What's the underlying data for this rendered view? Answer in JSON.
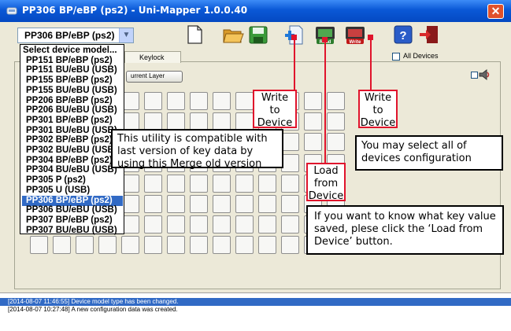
{
  "window": {
    "title": "PP306 BP/eBP (ps2)  - Uni-Mapper 1.0.0.40",
    "close_label": "✕"
  },
  "toolbar": {
    "model_select_value": "PP306 BP/eBP (ps2)",
    "buttons": [
      {
        "name": "new-file",
        "icon": "document-icon"
      },
      {
        "name": "open-folder",
        "icon": "folder-icon"
      },
      {
        "name": "save",
        "icon": "floppy-icon"
      },
      {
        "name": "new-add",
        "icon": "add-page-icon"
      },
      {
        "name": "read-device",
        "icon": "read-chip-icon",
        "label": "Read"
      },
      {
        "name": "write-device",
        "icon": "write-chip-icon",
        "label": "Write"
      },
      {
        "name": "help",
        "icon": "question-icon"
      },
      {
        "name": "exit",
        "icon": "exit-door-icon"
      }
    ]
  },
  "model_list": {
    "items": [
      "Select device model...",
      "PP151 BP/eBP (ps2)",
      "PP151 BU/eBU (USB)",
      "PP155 BP/eBP (ps2)",
      "PP155 BU/eBU (USB)",
      "PP206 BP/eBP (ps2)",
      "PP206 BU/eBU (USB)",
      "PP301 BP/eBP (ps2)",
      "PP301 BU/eBU (USB)",
      "PP302 BP/eBP (ps2)",
      "PP302 BU/eBU (USB)",
      "PP304 BP/eBP (ps2)",
      "PP304 BU/eBU (USB)",
      "PP305 P (ps2)",
      "PP305 U (USB)",
      "PP306 BP/eBP (ps2)",
      "PP306 BU/eBU (USB)",
      "PP307 BP/eBP (ps2)",
      "PP307 BU/eBU (USB)"
    ],
    "selected_index": 15
  },
  "content": {
    "tab_keylock": "Keylock",
    "current_layer_button": "urrent Layer",
    "all_devices_label": "All Devices"
  },
  "log": {
    "lines": [
      "[2014-08-07 11:46:55] Device model type has been changed.",
      "[2014-08-07 10:27:48] A new configuration data was created."
    ]
  },
  "annotations": {
    "write_to_device_1": "Write\nto\nDevice",
    "write_to_device_2": "Write\nto\nDevice",
    "load_from_device": "Load\nfrom\nDevice",
    "compat_note": "This utility is compatible with last version of key data by using this Merge old version",
    "select_all_note": "You may select all of devices configuration",
    "load_note": "If you want to know what key value saved, plese click the ‘Load from Device’ button."
  },
  "colors": {
    "titlebar": "#0a58d6",
    "selection": "#316ac5",
    "callout_red": "#e0142c"
  }
}
